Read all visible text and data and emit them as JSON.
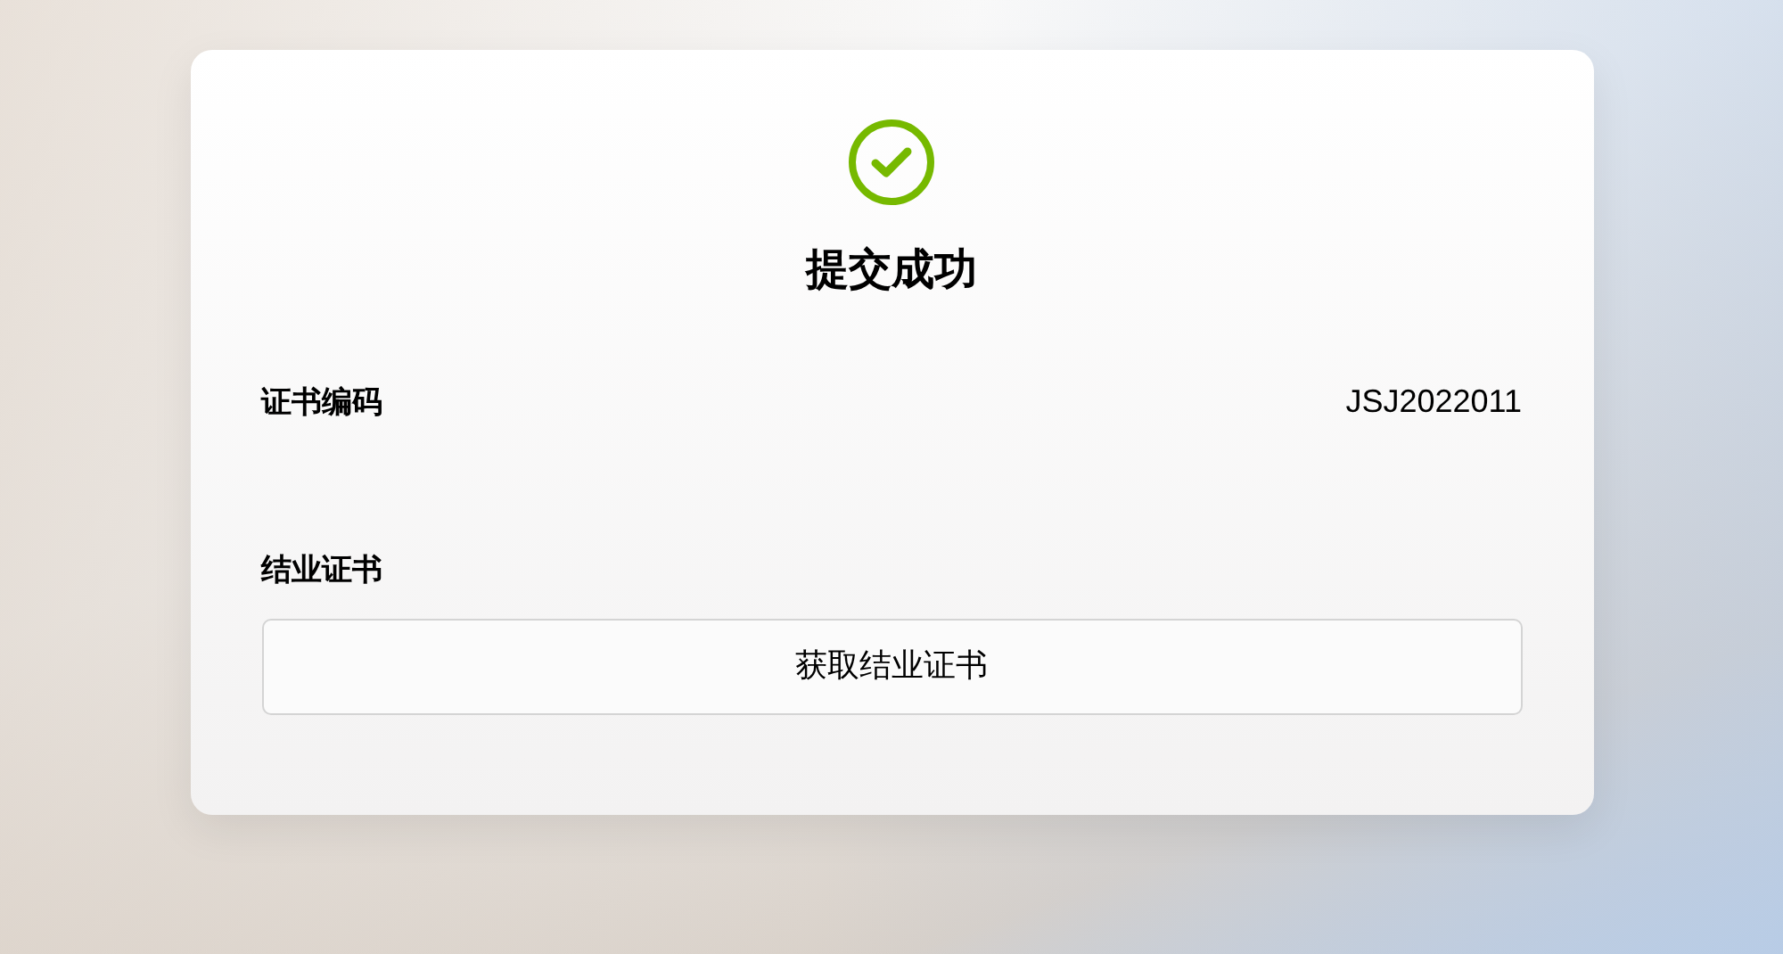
{
  "title": "提交成功",
  "fields": [
    {
      "label": "证书编码",
      "value": "JSJ2022011"
    }
  ],
  "certificate": {
    "label": "结业证书",
    "button": "获取结业证书"
  }
}
